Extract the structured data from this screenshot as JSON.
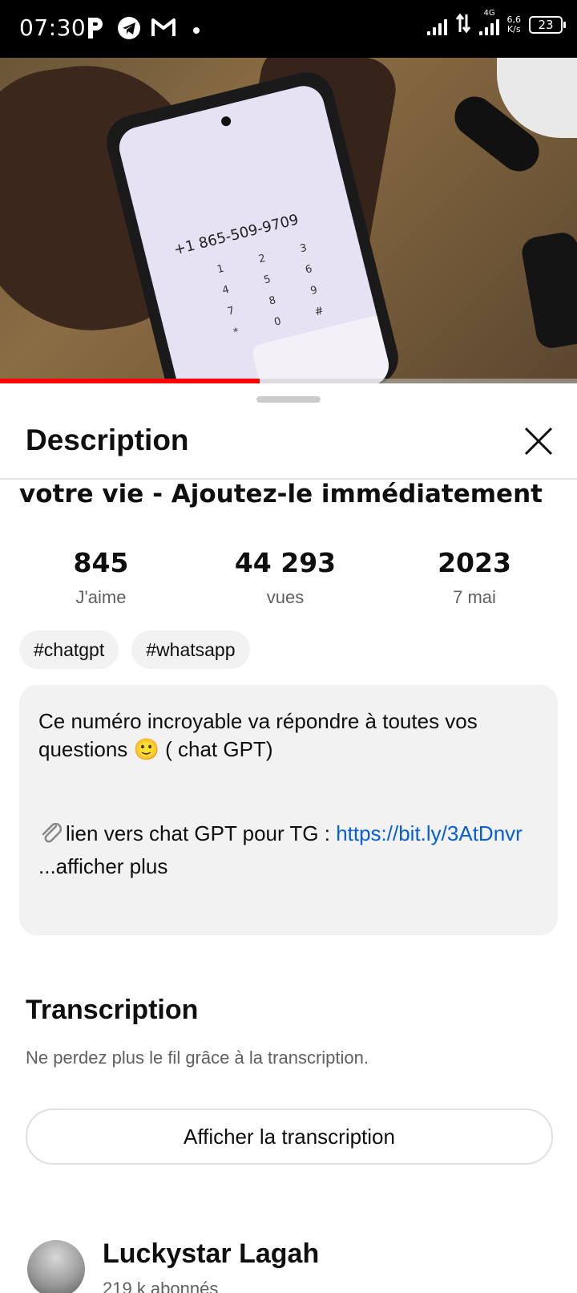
{
  "status_bar": {
    "time": "07:30",
    "app_icons": [
      "parking-icon",
      "telegram-icon",
      "gmail-icon",
      "dot-icon"
    ],
    "network_label": "4G",
    "speed_value": "6,6",
    "speed_unit": "K/s",
    "battery": "23"
  },
  "video": {
    "progress": 0.45
  },
  "sheet": {
    "title": "Description",
    "close_icon": "close-icon"
  },
  "video_title_partial": "votre vie - Ajoutez-le immédiatement",
  "stats": [
    {
      "value": "845",
      "label": "J'aime"
    },
    {
      "value": "44 293",
      "label": "vues"
    },
    {
      "value": "2023",
      "label": "7 mai"
    }
  ],
  "tags": [
    "#chatgpt",
    "#whatsapp"
  ],
  "description": {
    "line1": "Ce numéro incroyable va répondre à toutes vos questions 🙂 ( chat GPT)",
    "clip_icon": "paperclip-icon",
    "line2_prefix": "lien vers chat GPT pour TG : ",
    "link": "https://bit.ly/3AtDnvr",
    "more": "...afficher plus"
  },
  "transcription": {
    "title": "Transcription",
    "subtitle": "Ne perdez plus le fil grâce à la transcription.",
    "button": "Afficher la transcription"
  },
  "channel": {
    "name": "Luckystar Lagah",
    "subscribers": "219 k abonnés"
  },
  "colors": {
    "progress_red": "#ff0000",
    "link_blue": "#065fd4",
    "secondary_text": "#606060",
    "card_bg": "#f2f2f2"
  }
}
